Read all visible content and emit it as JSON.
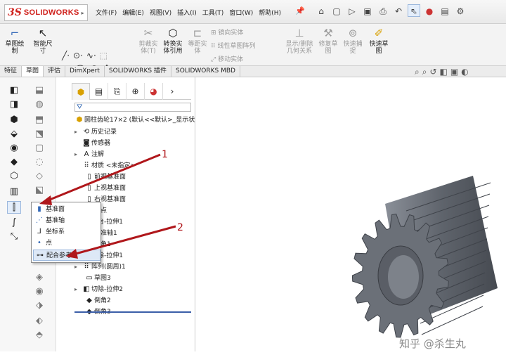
{
  "app": {
    "logo_ds": "3S",
    "logo_name": "SOLIDWORKS"
  },
  "menubar": {
    "items": [
      "文件(F)",
      "编辑(E)",
      "视图(V)",
      "插入(I)",
      "工具(T)",
      "窗口(W)",
      "帮助(H)"
    ]
  },
  "ribbon": {
    "sketch": "草图绘\n制",
    "smart_dim": "智能尺\n寸",
    "convert": "转换实\n体引用",
    "trim_dim": "剪裁实\n体(T)",
    "offset": "等距实\n体",
    "mirror": "镜向实体",
    "linear_pattern": "线性草图阵列",
    "move": "移动实体",
    "display_delete": "显示/删除\n几何关系",
    "repair": "修复草\n图",
    "quick_snap": "快速捕\n捉",
    "rapid_sketch": "快速草\n图"
  },
  "tabs": [
    "特征",
    "草图",
    "评估",
    "DimXpert",
    "SOLIDWORKS 插件",
    "SOLIDWORKS MBD"
  ],
  "feature_tree": {
    "root": "圆柱齿轮17×2  (默认<<默认>_显示状",
    "nodes": [
      {
        "label": "历史记录",
        "expand": true
      },
      {
        "label": "传感器",
        "expand": false
      },
      {
        "label": "注解",
        "expand": true
      },
      {
        "label": "材质 <未指定>",
        "expand": false
      },
      {
        "label": "前视基准面",
        "expand": false
      },
      {
        "label": "上视基准面",
        "expand": false
      },
      {
        "label": "右视基准面",
        "expand": false
      },
      {
        "label": "原点",
        "expand": false
      },
      {
        "label": "凸台-拉伸1",
        "expand": true
      },
      {
        "label": "基准轴1",
        "expand": false
      },
      {
        "label": "倒角1",
        "expand": false
      },
      {
        "label": "切除-拉伸1",
        "expand": true
      },
      {
        "label": "阵列(圆周)1",
        "expand": true
      },
      {
        "label": "草图3",
        "expand": false
      },
      {
        "label": "切除-拉伸2",
        "expand": true
      },
      {
        "label": "倒角2",
        "expand": false
      },
      {
        "label": "倒角3",
        "expand": false
      }
    ]
  },
  "flyout": {
    "items": [
      "基准面",
      "基准轴",
      "坐标系",
      "点",
      "配合参考"
    ]
  },
  "annotations": [
    "1",
    "2"
  ],
  "watermark": "知乎 @杀生丸",
  "colors": {
    "accent_red": "#d0211c",
    "arrow_red": "#b0171b",
    "gear": "#6b7078"
  }
}
